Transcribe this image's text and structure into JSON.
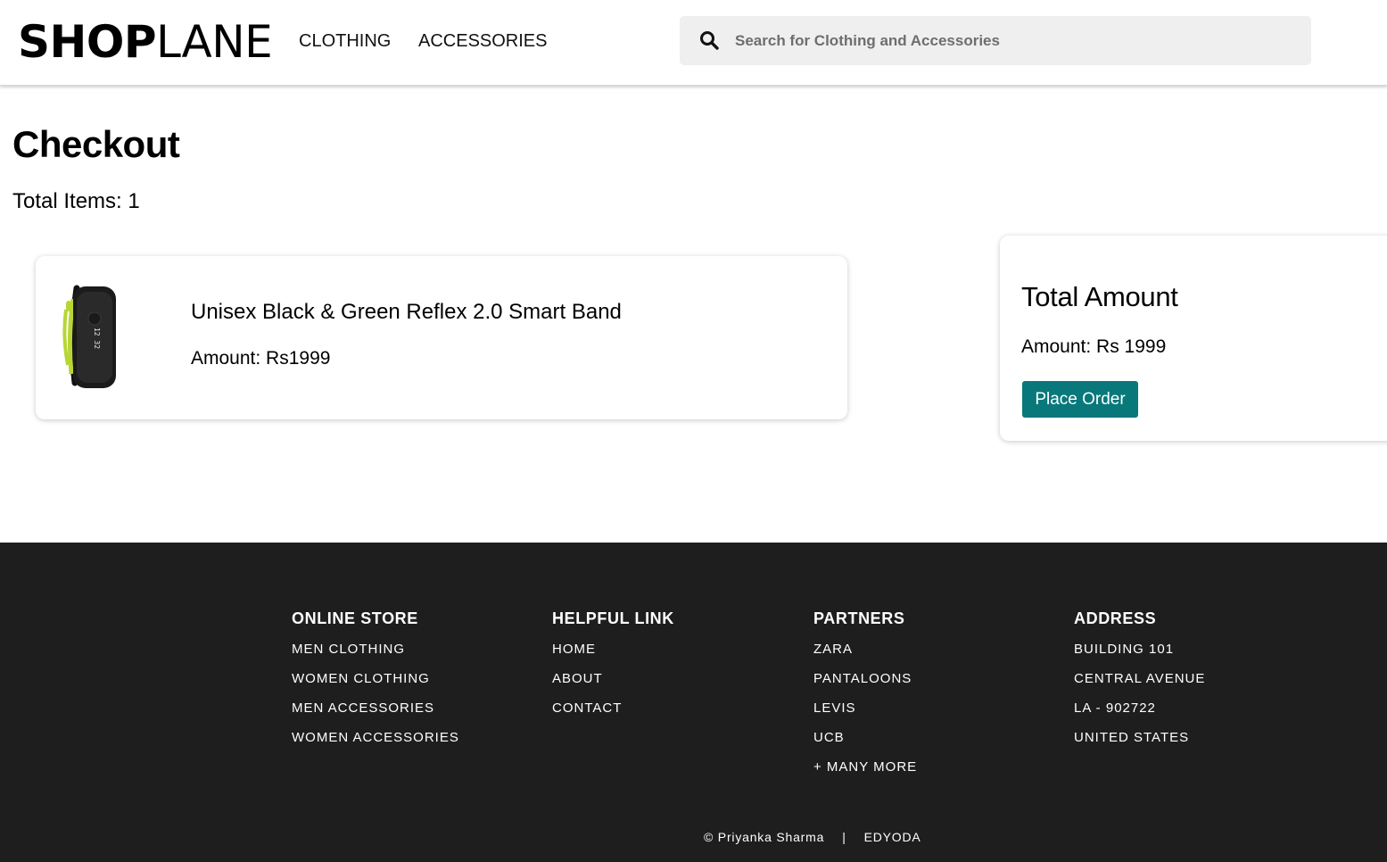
{
  "header": {
    "logo_bold": "SHOP",
    "logo_light": "LANE",
    "nav": [
      "CLOTHING",
      "ACCESSORIES"
    ],
    "search": {
      "placeholder": "Search for Clothing and Accessories",
      "value": "",
      "icon": "search-icon"
    }
  },
  "checkout": {
    "title": "Checkout",
    "total_items": "Total Items: 1",
    "items": [
      {
        "name": "Unisex Black & Green Reflex 2.0 Smart Band",
        "amount": "Amount: Rs1999",
        "image": "smart-band-image"
      }
    ]
  },
  "summary": {
    "title": "Total Amount",
    "amount": "Amount: Rs 1999",
    "button": "Place Order"
  },
  "footer": {
    "columns": [
      {
        "title": "ONLINE STORE",
        "links": [
          "MEN CLOTHING",
          "WOMEN CLOTHING",
          "MEN ACCESSORIES",
          "WOMEN ACCESSORIES"
        ]
      },
      {
        "title": "HELPFUL LINK",
        "links": [
          "HOME",
          "ABOUT",
          "CONTACT"
        ]
      },
      {
        "title": "PARTNERS",
        "links": [
          "ZARA",
          "PANTALOONS",
          "LEVIS",
          "UCB",
          "+ MANY MORE"
        ]
      },
      {
        "title": "ADDRESS",
        "links": [
          "BUILDING 101",
          "CENTRAL AVENUE",
          "LA - 902722",
          "UNITED STATES"
        ]
      }
    ],
    "copyright": "© Priyanka Sharma",
    "separator": "|",
    "brand": "EDYODA"
  },
  "colors": {
    "accent": "#08787b",
    "footer_bg": "#1e1e1e",
    "band_green": "#b7d635"
  }
}
